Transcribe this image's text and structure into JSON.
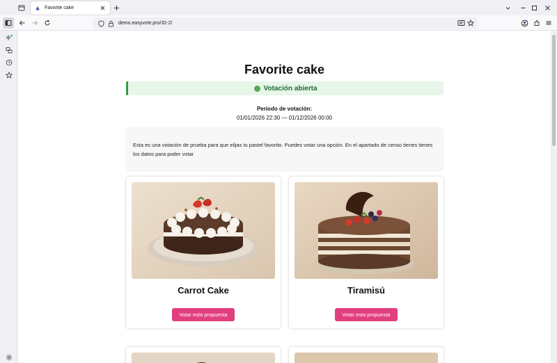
{
  "browser": {
    "tab_title": "Favorite cake",
    "url": "demo.easyvote.pro/32-2/"
  },
  "page": {
    "title": "Favorite cake",
    "status_text": "Votación abierta",
    "status_color": "#2e9e44",
    "period_label": "Periodo de votación:",
    "period_range": "01/01/2026 22:30 — 01/12/2026 00:00",
    "description": "Esta es una votación de prueba para que elijas tu pastel favorito. Puedes votar una opción. En el apartado de censo tienes tienes los datos para poder votar",
    "accent_color": "#e23f7f"
  },
  "options": [
    {
      "name": "Carrot Cake",
      "button_label": "Votar esta propuesta",
      "image": "carrot-cake-photo"
    },
    {
      "name": "Tiramisú",
      "button_label": "Votar esta propuesta",
      "image": "tiramisu-photo"
    }
  ]
}
